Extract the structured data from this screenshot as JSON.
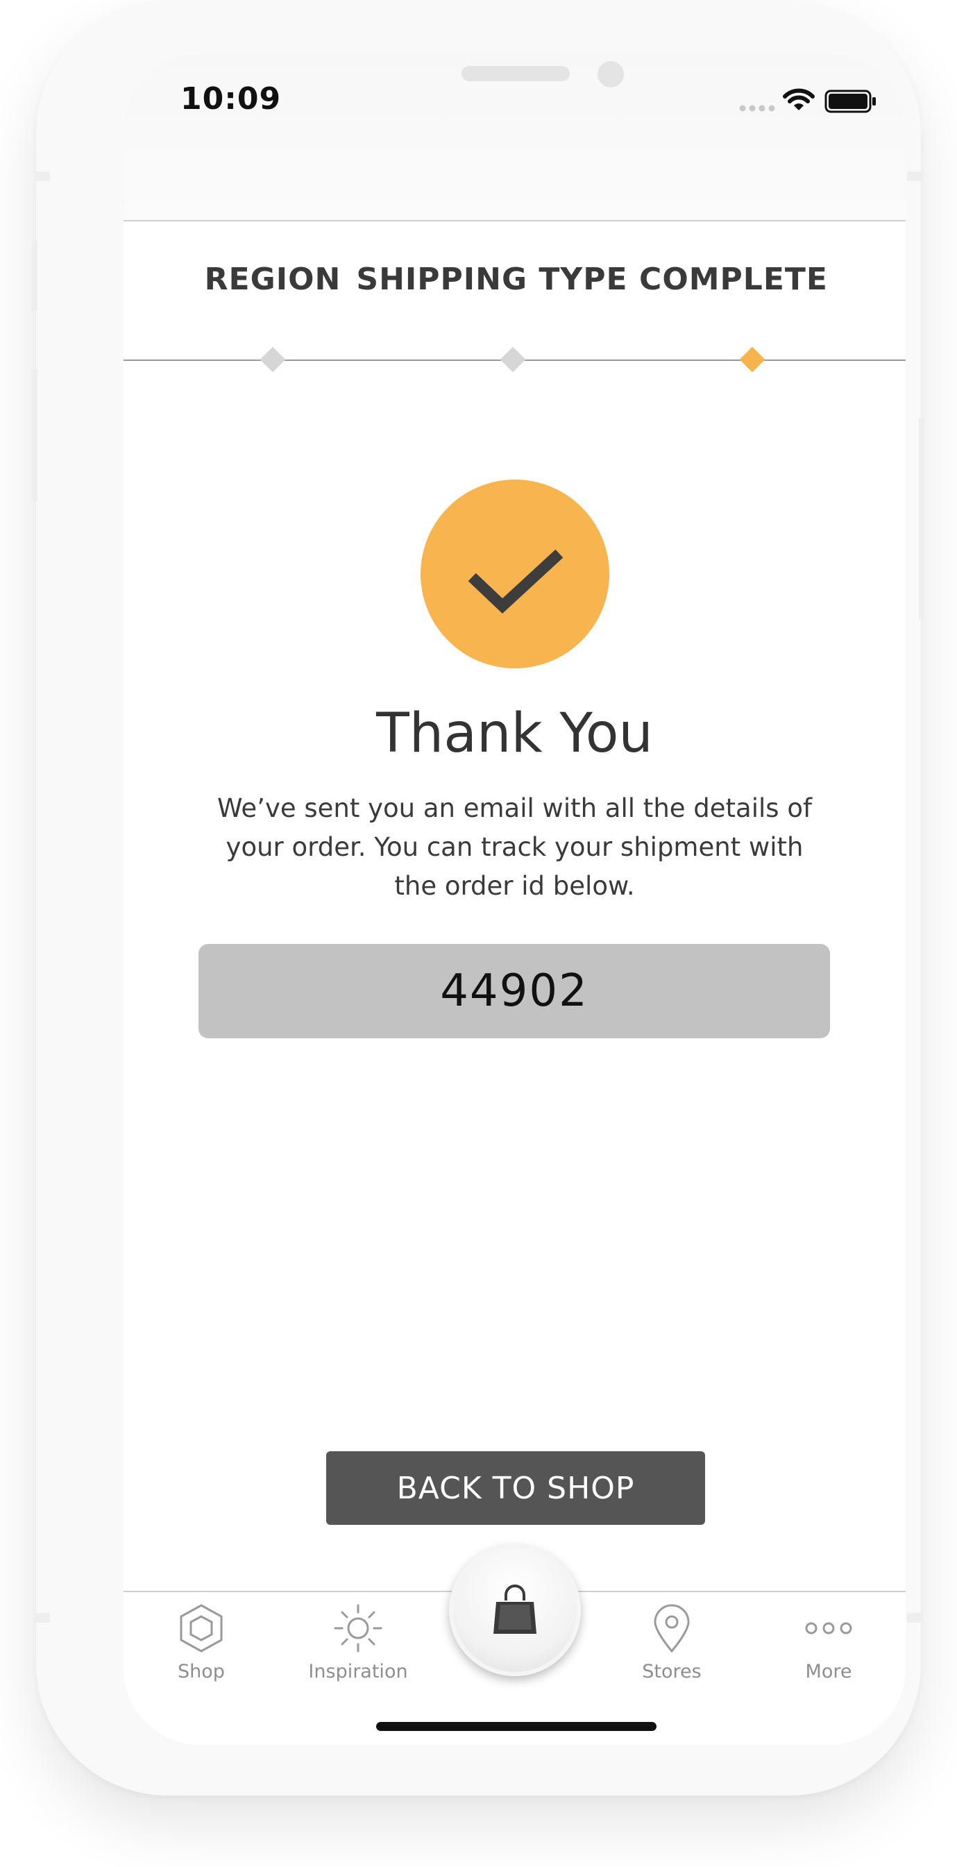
{
  "status_bar": {
    "time": "10:09"
  },
  "steps": [
    {
      "label": "REGION",
      "active": false
    },
    {
      "label": "SHIPPING TYPE",
      "active": false
    },
    {
      "label": "COMPLETE",
      "active": true
    }
  ],
  "colors": {
    "accent": "#f8b44e",
    "dark": "#555555",
    "order_box": "#c2c2c2"
  },
  "confirmation": {
    "icon": "checkmark-icon",
    "title": "Thank You",
    "message": "We’ve sent you an email with all the details of your order. You can track your shipment with the order id below.",
    "order_id": "44902"
  },
  "actions": {
    "back_to_shop": "BACK TO SHOP"
  },
  "tabbar": {
    "shop": {
      "label": "Shop",
      "icon": "hexagon-icon"
    },
    "inspiration": {
      "label": "Inspiration",
      "icon": "sun-icon"
    },
    "cart": {
      "icon": "shopping-bag-icon"
    },
    "stores": {
      "label": "Stores",
      "icon": "location-pin-icon"
    },
    "more": {
      "label": "More",
      "icon": "more-dots-icon"
    }
  }
}
